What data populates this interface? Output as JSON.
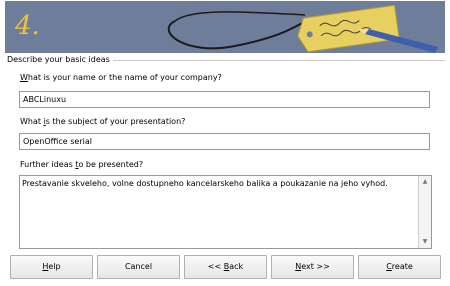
{
  "banner": {
    "step_number": "4."
  },
  "group": {
    "title": "Describe your basic ideas"
  },
  "fields": {
    "company_label_mnemonic": "W",
    "company_label_rest": "hat is your name or the name of your company?",
    "company_value": "ABCLinuxu",
    "subject_label_pre": "What ",
    "subject_label_mnemonic": "i",
    "subject_label_rest": "s the subject of your presentation?",
    "subject_value": "OpenOffice serial",
    "ideas_label_pre": "Further ideas ",
    "ideas_label_mnemonic": "t",
    "ideas_label_rest": "o be presented?",
    "ideas_value": "Prestavanie skveleho, volne dostupneho kancelarskeho balika a poukazanie na jeho vyhod."
  },
  "buttons": {
    "help_mnemonic": "H",
    "help_rest": "elp",
    "cancel": "Cancel",
    "back_pre": "<< ",
    "back_mnemonic": "B",
    "back_rest": "ack",
    "next_mnemonic": "N",
    "next_rest": "ext >>",
    "create_mnemonic": "C",
    "create_rest": "reate"
  },
  "colors": {
    "banner_bg": "#6e7e9a",
    "step_number": "#f0c040",
    "tag": "#e8d060"
  }
}
